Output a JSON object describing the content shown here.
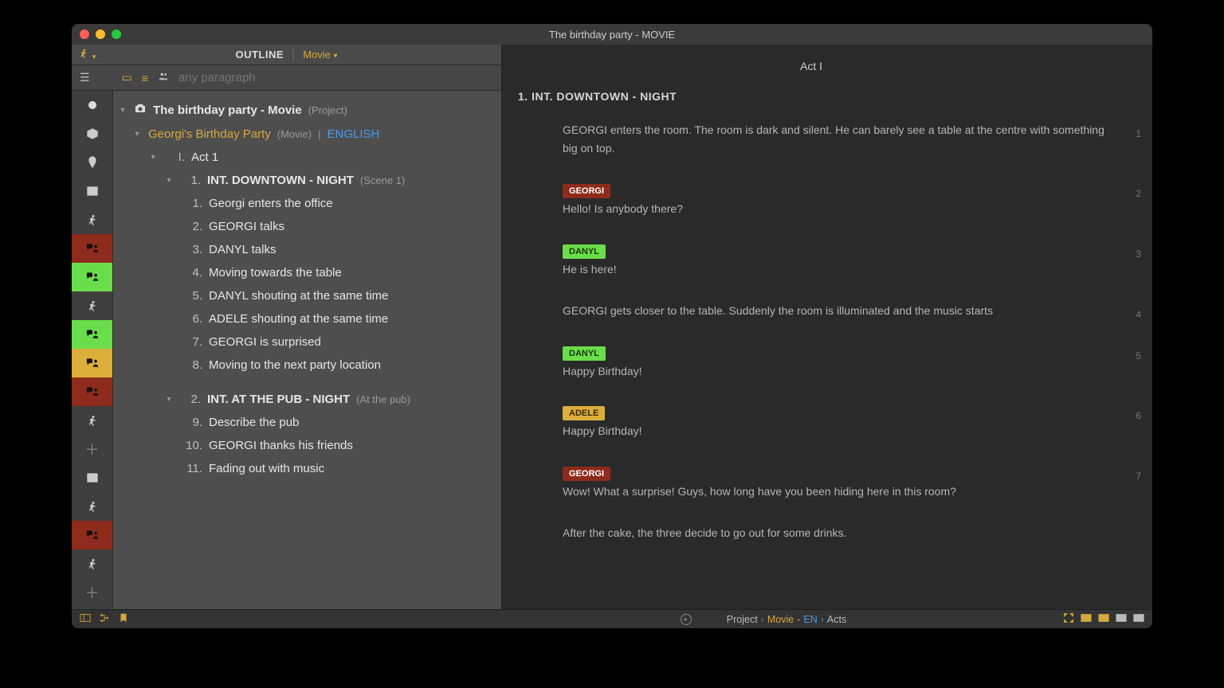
{
  "window": {
    "title": "The birthday party - MOVIE"
  },
  "leftHeader": {
    "label": "OUTLINE",
    "typeLabel": "Movie"
  },
  "search": {
    "placeholder": "any paragraph"
  },
  "tree": {
    "project": {
      "title": "The birthday party - Movie",
      "meta": "(Project)"
    },
    "movie": {
      "title": "Georgi's Birthday Party",
      "meta": "(Movie)",
      "sep": "|",
      "lang": "ENGLISH"
    },
    "act": {
      "roman": "I.",
      "title": "Act 1"
    },
    "scene1": {
      "num": "1.",
      "title": "INT.  DOWNTOWN - NIGHT",
      "meta": "(Scene 1)"
    },
    "beats1": [
      {
        "num": "1.",
        "label": "Georgi enters the office"
      },
      {
        "num": "2.",
        "label": "GEORGI talks"
      },
      {
        "num": "3.",
        "label": "DANYL talks"
      },
      {
        "num": "4.",
        "label": "Moving towards the table"
      },
      {
        "num": "5.",
        "label": "DANYL shouting at the same time"
      },
      {
        "num": "6.",
        "label": "ADELE shouting at the same time"
      },
      {
        "num": "7.",
        "label": "GEORGI is surprised"
      },
      {
        "num": "8.",
        "label": "Moving to the next party location"
      }
    ],
    "scene2": {
      "num": "2.",
      "title": "INT.  AT THE PUB - NIGHT",
      "meta": "(At the pub)"
    },
    "beats2": [
      {
        "num": "9.",
        "label": "Describe the pub"
      },
      {
        "num": "10.",
        "label": "GEORGI thanks his friends"
      },
      {
        "num": "11.",
        "label": "Fading out with music"
      }
    ]
  },
  "script": {
    "act": "Act I",
    "scene": "1.  INT. DOWNTOWN - NIGHT",
    "blocks": [
      {
        "kind": "action",
        "text": "GEORGI enters the room. The room is dark and silent. He can barely see a table at the centre with something big on top.",
        "pg": "1"
      },
      {
        "kind": "dialog",
        "char": "GEORGI",
        "color": "red",
        "text": "Hello! Is anybody there?",
        "pg": "2"
      },
      {
        "kind": "dialog",
        "char": "DANYL",
        "color": "green",
        "text": "He is here!",
        "pg": "3"
      },
      {
        "kind": "action",
        "text": "GEORGI gets closer to the table. Suddenly the room is illuminated and the music starts",
        "pg": "4"
      },
      {
        "kind": "dialog",
        "char": "DANYL",
        "color": "green",
        "text": "Happy Birthday!",
        "pg": "5"
      },
      {
        "kind": "dialog",
        "char": "ADELE",
        "color": "yellow",
        "text": "Happy Birthday!",
        "pg": "6"
      },
      {
        "kind": "dialog",
        "char": "GEORGI",
        "color": "red",
        "text": "Wow! What a surprise! Guys, how long have you been hiding here in this room?",
        "pg": "7"
      },
      {
        "kind": "action",
        "text": "After the cake, the three decide to go out for some drinks.",
        "pg": ""
      }
    ]
  },
  "status": {
    "crumb1": "Project",
    "crumb2a": "Movie",
    "crumb2b": "EN",
    "crumb3": "Acts",
    "sep": "›",
    "dash": "-"
  },
  "railIcons": [
    {
      "name": "dot-icon",
      "glyph": "dot",
      "cls": ""
    },
    {
      "name": "cube-icon",
      "glyph": "cube",
      "cls": ""
    },
    {
      "name": "pin-icon",
      "glyph": "pin",
      "cls": ""
    },
    {
      "name": "film-icon",
      "glyph": "film",
      "cls": ""
    },
    {
      "name": "running-icon",
      "glyph": "run",
      "cls": ""
    },
    {
      "name": "speech-person-icon",
      "glyph": "sp",
      "cls": "red"
    },
    {
      "name": "speech-person-icon",
      "glyph": "sp",
      "cls": "green"
    },
    {
      "name": "running-icon",
      "glyph": "run",
      "cls": ""
    },
    {
      "name": "speech-person-icon",
      "glyph": "sp",
      "cls": "green"
    },
    {
      "name": "speech-person-icon",
      "glyph": "sp",
      "cls": "yellow"
    },
    {
      "name": "speech-person-icon",
      "glyph": "sp",
      "cls": "red"
    },
    {
      "name": "running-icon",
      "glyph": "run",
      "cls": ""
    },
    {
      "name": "plus-icon",
      "glyph": "plus",
      "cls": ""
    },
    {
      "name": "film-icon",
      "glyph": "film",
      "cls": ""
    },
    {
      "name": "running-icon",
      "glyph": "run",
      "cls": ""
    },
    {
      "name": "speech-person-icon",
      "glyph": "sp",
      "cls": "red"
    },
    {
      "name": "running-icon",
      "glyph": "run",
      "cls": ""
    },
    {
      "name": "plus-icon",
      "glyph": "plus",
      "cls": ""
    }
  ]
}
